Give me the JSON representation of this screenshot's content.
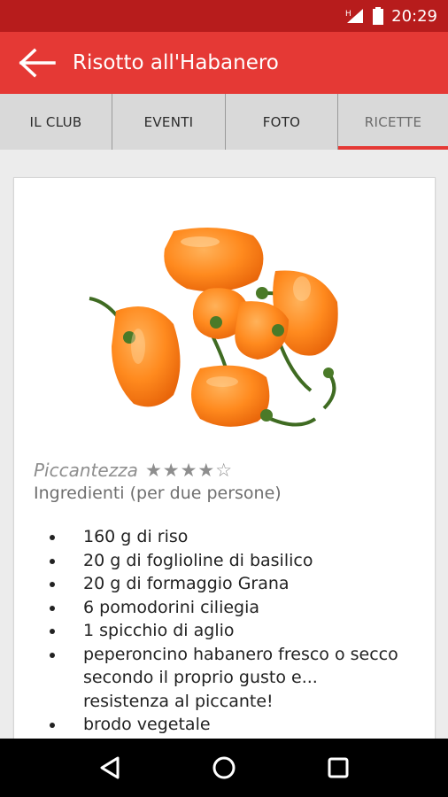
{
  "status_bar": {
    "time": "20:29",
    "network_label": "H"
  },
  "app_bar": {
    "title": "Risotto all'Habanero"
  },
  "tabs": [
    {
      "label": "IL CLUB",
      "active": false
    },
    {
      "label": "EVENTI",
      "active": false
    },
    {
      "label": "FOTO",
      "active": false
    },
    {
      "label": "RICETTE",
      "active": true
    }
  ],
  "recipe": {
    "photo_alt": "habanero peppers",
    "spiciness_label": "Piccantezza",
    "spiciness_stars": "★★★★☆",
    "spiciness_value": 4,
    "spiciness_max": 5,
    "ingredients_title": "Ingredienti (per due persone)",
    "ingredients": [
      "160 g di riso",
      "20 g di foglioline di basilico",
      "20 g di formaggio Grana",
      "6 pomodorini ciliegia",
      "1 spicchio di aglio",
      "peperoncino habanero fresco o secco secondo il proprio gusto e... resistenza al piccante!",
      "brodo vegetale"
    ]
  },
  "colors": {
    "primary": "#e53935",
    "status_bar": "#b71c1c",
    "tab_bg": "#d9d9d9",
    "indicator": "#e53935"
  },
  "icons": {
    "back": "arrow-back-icon",
    "nav_back": "triangle-back-icon",
    "nav_home": "circle-home-icon",
    "nav_recents": "square-recents-icon"
  }
}
